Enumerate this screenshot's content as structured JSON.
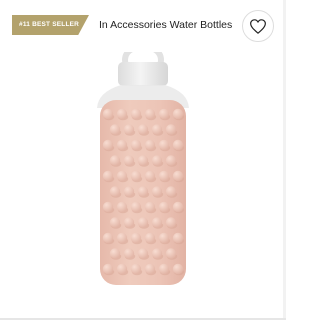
{
  "header": {
    "badge_label": "#11 BEST SELLER",
    "category_text": "In Accessories Water Bottles",
    "favorite_icon": "heart-outline-icon"
  },
  "product": {
    "image_icon": "spiked-water-bottle",
    "colors": {
      "sleeve": "#ecc4b6",
      "spike": "#f3d2c6",
      "cap": "#ebebeb",
      "badge": "#b3a26c"
    }
  }
}
